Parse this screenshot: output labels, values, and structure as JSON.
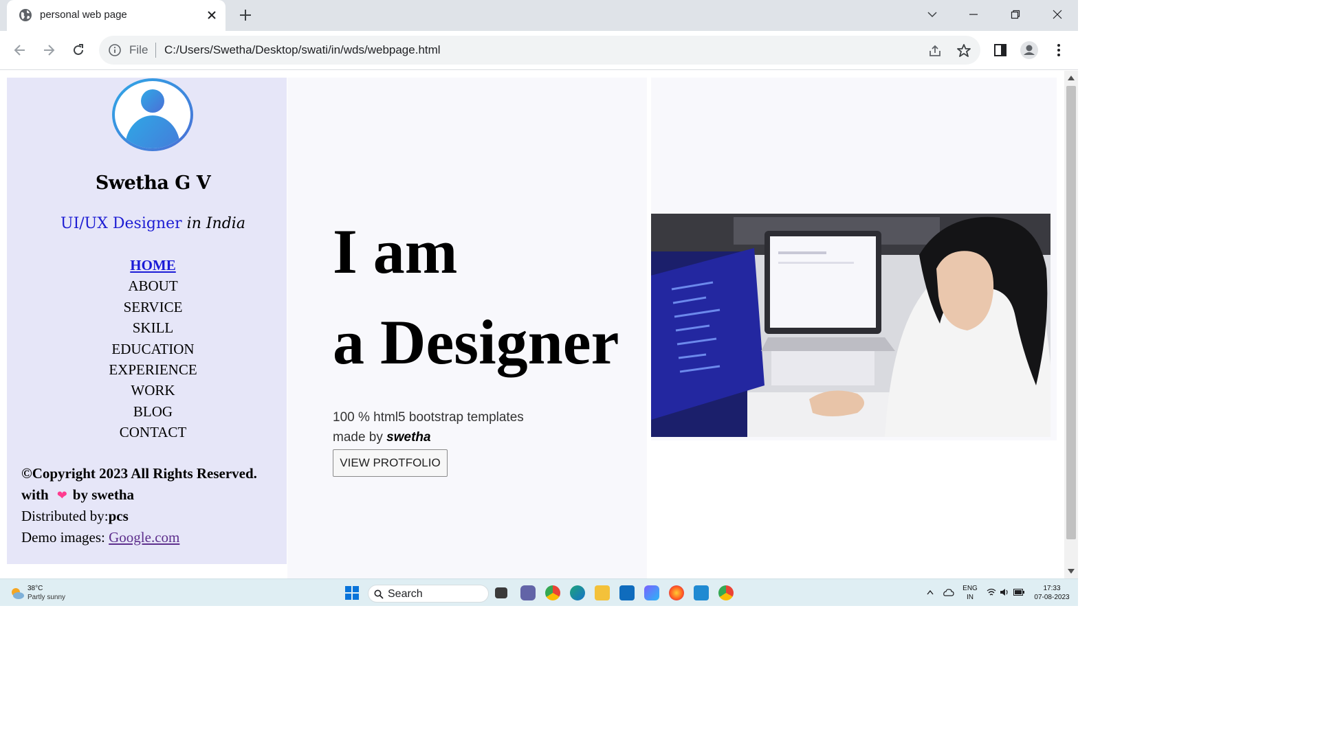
{
  "browser": {
    "tab_title": "personal web page",
    "omnibox_prefix": "File",
    "url": "C:/Users/Swetha/Desktop/swati/in/wds/webpage.html"
  },
  "sidebar": {
    "name": "Swetha G V",
    "role_main": "UI/UX Designer",
    "role_suffix": "in India",
    "menu": [
      "HOME",
      "ABOUT",
      "SERVICE",
      "SKILL",
      "EDUCATION",
      "EXPERIENCE",
      "WORK",
      "BLOG",
      "CONTACT"
    ],
    "active_item": "HOME",
    "footer": {
      "copyright": "©Copyright 2023 All Rights Reserved.",
      "with_prefix": "with",
      "with_suffix": "by swetha",
      "distributed_label": "Distributed by:",
      "distributed_value": "pcs",
      "demo_label": "Demo images:",
      "demo_link": "Google.com"
    }
  },
  "hero": {
    "line1": "I am",
    "line2": "a Designer",
    "subtitle": "100 % html5 bootstrap templates",
    "made_by_prefix": "made by",
    "made_by_name": "swetha",
    "button": "VIEW PROTFOLIO"
  },
  "taskbar": {
    "weather_temp": "38°C",
    "weather_desc": "Partly sunny",
    "search_label": "Search",
    "lang": "ENG",
    "region": "IN",
    "time": "17:33",
    "date": "07-08-2023"
  },
  "colors": {
    "sidebar_bg": "#e6e6f8",
    "hero_bg": "#f8f8fc",
    "accent_blue": "#1d1dd3",
    "link_purple": "#5d2e8c"
  },
  "icons": [
    "globe-icon",
    "close-icon",
    "plus-icon",
    "back-icon",
    "forward-icon",
    "reload-icon",
    "info-icon",
    "share-icon",
    "star-icon",
    "sidepanel-icon",
    "profile-icon",
    "more-icon",
    "user-avatar-icon",
    "heart-icon",
    "search-icon"
  ]
}
